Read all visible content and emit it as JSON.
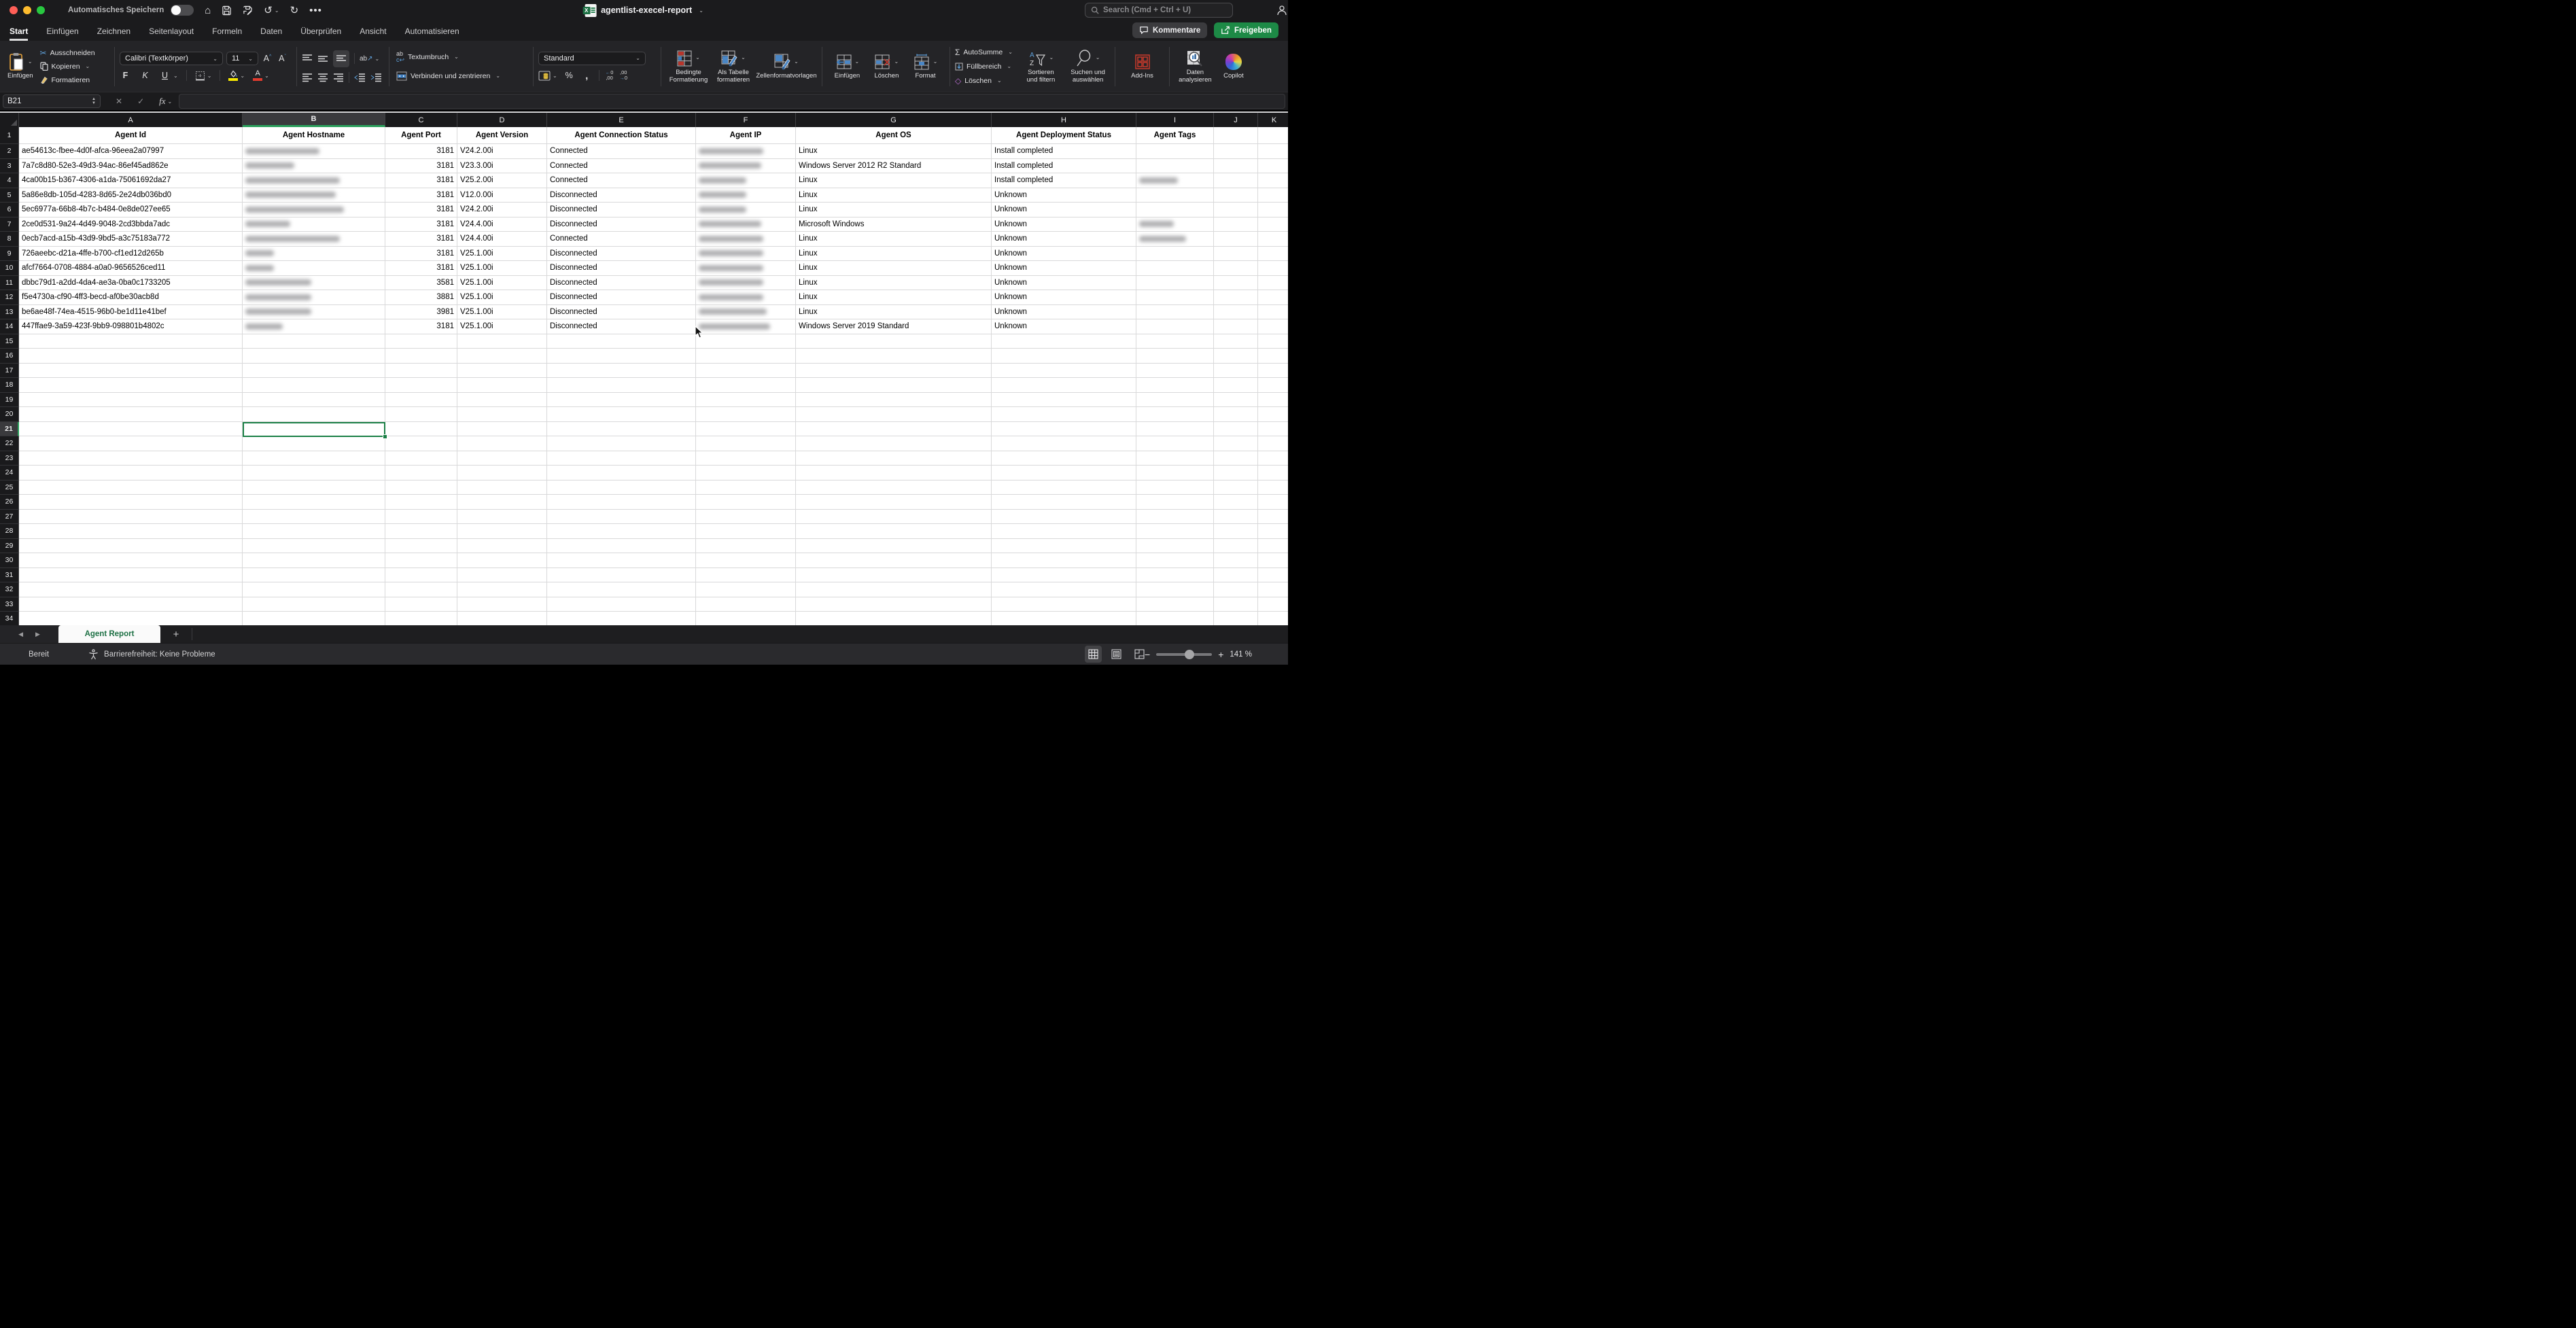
{
  "titlebar": {
    "autosave_label": "Automatisches Speichern",
    "doc_title": "agentlist-execel-report",
    "search_placeholder": "Search (Cmd + Ctrl + U)"
  },
  "ribbon_tabs": {
    "items": [
      "Start",
      "Einfügen",
      "Zeichnen",
      "Seitenlayout",
      "Formeln",
      "Daten",
      "Überprüfen",
      "Ansicht",
      "Automatisieren"
    ],
    "active": "Start",
    "comments": "Kommentare",
    "share": "Freigeben"
  },
  "ribbon": {
    "paste": "Einfügen",
    "cut": "Ausschneiden",
    "copy": "Kopieren",
    "format_painter": "Formatieren",
    "font_name": "Calibri (Textkörper)",
    "font_size": "11",
    "bold": "F",
    "italic": "K",
    "underline": "U",
    "wrap": "Textumbruch",
    "merge": "Verbinden und zentrieren",
    "number_format": "Standard",
    "conditional": "Bedingte Formatierung",
    "as_table": "Als Tabelle formatieren",
    "cell_styles": "Zellenformatvorlagen",
    "insert": "Einfügen",
    "delete": "Löschen",
    "format": "Format",
    "autosum": "AutoSumme",
    "fill": "Füllbereich",
    "clear": "Löschen",
    "sort": "Sortieren und filtern",
    "find": "Suchen und auswählen",
    "addins": "Add-Ins",
    "analyze": "Daten analysieren",
    "copilot": "Copilot"
  },
  "formula_bar": {
    "name_box": "B21",
    "fx": "fx",
    "value": ""
  },
  "sheet": {
    "columns": [
      "A",
      "B",
      "C",
      "D",
      "E",
      "F",
      "G",
      "H",
      "I",
      "J",
      "K"
    ],
    "selected_column": "B",
    "selected_row": 21,
    "selected_cell": "B21",
    "row_count": 34,
    "headers": [
      "Agent Id",
      "Agent Hostname",
      "Agent Port",
      "Agent Version",
      "Agent Connection Status",
      "Agent IP",
      "Agent OS",
      "Agent Deployment Status",
      "Agent Tags"
    ],
    "rows": [
      {
        "id": "ae54613c-fbee-4d0f-afca-96eea2a07997",
        "port": "3181",
        "version": "V24.2.00i",
        "connection": "Connected",
        "os": "Linux",
        "deployment": "Install completed",
        "hostname_redacted": true,
        "ip_redacted": true,
        "hostname_blur_w": 109,
        "ip_blur_w": 95,
        "tags_blur_w": 0
      },
      {
        "id": "7a7c8d80-52e3-49d3-94ac-86ef45ad862e",
        "port": "3181",
        "version": "V23.3.00i",
        "connection": "Connected",
        "os": "Windows Server 2012 R2 Standard",
        "deployment": "Install completed",
        "hostname_redacted": true,
        "ip_redacted": true,
        "hostname_blur_w": 72,
        "ip_blur_w": 92,
        "tags_blur_w": 0
      },
      {
        "id": "4ca00b15-b367-4306-a1da-75061692da27",
        "port": "3181",
        "version": "V25.2.00i",
        "connection": "Connected",
        "os": "Linux",
        "deployment": "Install completed",
        "hostname_redacted": true,
        "ip_redacted": true,
        "hostname_blur_w": 139,
        "ip_blur_w": 70,
        "tags_blur_w": 57
      },
      {
        "id": "5a86e8db-105d-4283-8d65-2e24db036bd0",
        "port": "3181",
        "version": "V12.0.00i",
        "connection": "Disconnected",
        "os": "Linux",
        "deployment": "Unknown",
        "hostname_redacted": true,
        "ip_redacted": true,
        "hostname_blur_w": 133,
        "ip_blur_w": 70,
        "tags_blur_w": 0
      },
      {
        "id": "5ec6977a-66b8-4b7c-b484-0e8de027ee65",
        "port": "3181",
        "version": "V24.2.00i",
        "connection": "Disconnected",
        "os": "Linux",
        "deployment": "Unknown",
        "hostname_redacted": true,
        "ip_redacted": true,
        "hostname_blur_w": 145,
        "ip_blur_w": 70,
        "tags_blur_w": 0
      },
      {
        "id": "2ce0d531-9a24-4d49-9048-2cd3bbda7adc",
        "port": "3181",
        "version": "V24.4.00i",
        "connection": "Disconnected",
        "os": "Microsoft Windows",
        "deployment": "Unknown",
        "hostname_redacted": true,
        "ip_redacted": true,
        "hostname_blur_w": 66,
        "ip_blur_w": 92,
        "tags_blur_w": 51
      },
      {
        "id": "0ecb7acd-a15b-43d9-9bd5-a3c75183a772",
        "port": "3181",
        "version": "V24.4.00i",
        "connection": "Connected",
        "os": "Linux",
        "deployment": "Unknown",
        "hostname_redacted": true,
        "ip_redacted": true,
        "hostname_blur_w": 139,
        "ip_blur_w": 95,
        "tags_blur_w": 69
      },
      {
        "id": "726aeebc-d21a-4ffe-b700-cf1ed12d265b",
        "port": "3181",
        "version": "V25.1.00i",
        "connection": "Disconnected",
        "os": "Linux",
        "deployment": "Unknown",
        "hostname_redacted": true,
        "ip_redacted": true,
        "hostname_blur_w": 42,
        "ip_blur_w": 95,
        "tags_blur_w": 0
      },
      {
        "id": "afcf7664-0708-4884-a0a0-9656526ced11",
        "port": "3181",
        "version": "V25.1.00i",
        "connection": "Disconnected",
        "os": "Linux",
        "deployment": "Unknown",
        "hostname_redacted": true,
        "ip_redacted": true,
        "hostname_blur_w": 42,
        "ip_blur_w": 95,
        "tags_blur_w": 0
      },
      {
        "id": "dbbc79d1-a2dd-4da4-ae3a-0ba0c1733205",
        "port": "3581",
        "version": "V25.1.00i",
        "connection": "Disconnected",
        "os": "Linux",
        "deployment": "Unknown",
        "hostname_redacted": true,
        "ip_redacted": true,
        "hostname_blur_w": 97,
        "ip_blur_w": 95,
        "tags_blur_w": 0
      },
      {
        "id": "f5e4730a-cf90-4ff3-becd-af0be30acb8d",
        "port": "3881",
        "version": "V25.1.00i",
        "connection": "Disconnected",
        "os": "Linux",
        "deployment": "Unknown",
        "hostname_redacted": true,
        "ip_redacted": true,
        "hostname_blur_w": 97,
        "ip_blur_w": 95,
        "tags_blur_w": 0
      },
      {
        "id": "be6ae48f-74ea-4515-96b0-be1d11e41bef",
        "port": "3981",
        "version": "V25.1.00i",
        "connection": "Disconnected",
        "os": "Linux",
        "deployment": "Unknown",
        "hostname_redacted": true,
        "ip_redacted": true,
        "hostname_blur_w": 97,
        "ip_blur_w": 100,
        "tags_blur_w": 0
      },
      {
        "id": "447ffae9-3a59-423f-9bb9-098801b4802c",
        "port": "3181",
        "version": "V25.1.00i",
        "connection": "Disconnected",
        "os": "Windows Server 2019 Standard",
        "deployment": "Unknown",
        "hostname_redacted": true,
        "ip_redacted": true,
        "hostname_blur_w": 55,
        "ip_blur_w": 105,
        "tags_blur_w": 0
      }
    ]
  },
  "sheet_tabs": {
    "active": "Agent Report"
  },
  "status_bar": {
    "mode": "Bereit",
    "accessibility": "Barrierefreiheit: Keine Probleme",
    "zoom_label": "141 %"
  }
}
